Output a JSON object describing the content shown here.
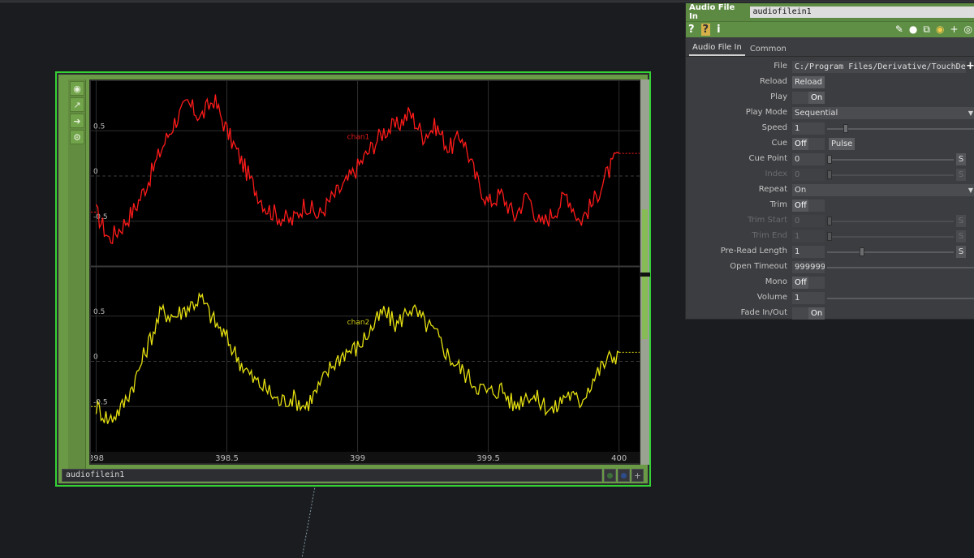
{
  "node": {
    "name": "audiofilein1",
    "toolbar_icons": [
      "target-icon",
      "chart-icon",
      "arrow-right-icon",
      "wrench-icon"
    ]
  },
  "chart_data": {
    "type": "line",
    "x_range": [
      397.98,
      400.06
    ],
    "x_ticks": [
      398,
      398.5,
      399,
      399.5,
      400
    ],
    "x_tick_labels": [
      "398",
      "398.5",
      "399",
      "399.5",
      "400"
    ],
    "channels": [
      {
        "name": "chan1",
        "color": "#ff1a1a",
        "y_range": [
          -1.0,
          1.05
        ],
        "y_ticks": [
          0.5,
          0,
          -0.5
        ],
        "y_tick_labels": [
          "0.5",
          "0",
          "-0.5"
        ],
        "x": [
          398.0,
          398.05,
          398.1,
          398.15,
          398.2,
          398.25,
          398.3,
          398.35,
          398.4,
          398.45,
          398.5,
          398.55,
          398.6,
          398.65,
          398.7,
          398.75,
          398.8,
          398.85,
          398.9,
          398.95,
          399.0,
          399.05,
          399.1,
          399.15,
          399.2,
          399.25,
          399.3,
          399.35,
          399.4,
          399.45,
          399.5,
          399.55,
          399.6,
          399.65,
          399.7,
          399.75,
          399.8,
          399.85,
          399.9,
          399.95,
          400.0
        ],
        "values": [
          -0.4,
          -0.7,
          -0.55,
          -0.35,
          -0.05,
          0.3,
          0.6,
          0.8,
          0.65,
          0.85,
          0.5,
          0.2,
          -0.1,
          -0.35,
          -0.45,
          -0.5,
          -0.3,
          -0.45,
          -0.25,
          -0.1,
          0.1,
          0.3,
          0.5,
          0.55,
          0.7,
          0.45,
          0.55,
          0.3,
          0.45,
          0.0,
          -0.3,
          -0.2,
          -0.45,
          -0.2,
          -0.55,
          -0.4,
          -0.2,
          -0.5,
          -0.3,
          0.0,
          0.25
        ]
      },
      {
        "name": "chan2",
        "color": "#e5e010",
        "y_range": [
          -1.0,
          1.05
        ],
        "y_ticks": [
          0.5,
          0,
          -0.5
        ],
        "y_tick_labels": [
          "0.5",
          "0",
          "-0.5"
        ],
        "x": [
          398.0,
          398.05,
          398.1,
          398.15,
          398.2,
          398.25,
          398.3,
          398.35,
          398.4,
          398.45,
          398.5,
          398.55,
          398.6,
          398.65,
          398.7,
          398.75,
          398.8,
          398.85,
          398.9,
          398.95,
          399.0,
          399.05,
          399.1,
          399.15,
          399.2,
          399.25,
          399.3,
          399.35,
          399.4,
          399.45,
          399.5,
          399.55,
          399.6,
          399.65,
          399.7,
          399.75,
          399.8,
          399.85,
          399.9,
          399.95,
          400.0
        ],
        "values": [
          -0.5,
          -0.65,
          -0.5,
          -0.2,
          0.2,
          0.55,
          0.5,
          0.6,
          0.7,
          0.45,
          0.25,
          0.0,
          -0.2,
          -0.3,
          -0.45,
          -0.4,
          -0.5,
          -0.3,
          -0.05,
          0.1,
          0.15,
          0.35,
          0.55,
          0.4,
          0.6,
          0.45,
          0.3,
          0.05,
          -0.1,
          -0.25,
          -0.35,
          -0.3,
          -0.5,
          -0.35,
          -0.45,
          -0.55,
          -0.35,
          -0.45,
          -0.2,
          0.0,
          0.1
        ]
      }
    ]
  },
  "panel": {
    "op_type": "Audio File In",
    "op_name": "audiofilein1",
    "header_icons": [
      "help-icon",
      "python-help-icon",
      "info-icon"
    ],
    "header_icons_text": [
      "?",
      "?",
      "i"
    ],
    "right_icons": [
      "pencil-icon",
      "comment-icon",
      "clone-icon",
      "python-icon",
      "plus-icon",
      "target-icon"
    ],
    "right_icons_text": [
      "✎",
      "●",
      "⧉",
      "◉",
      "+",
      "◎"
    ],
    "tabs": [
      "Audio File In",
      "Common"
    ],
    "params": {
      "file": {
        "label": "File",
        "value": "C:/Program Files/Derivative/TouchDe",
        "plus": "+"
      },
      "reload": {
        "label": "Reload",
        "button": "Reload"
      },
      "play": {
        "label": "Play",
        "off": "",
        "on": "On"
      },
      "play_mode": {
        "label": "Play Mode",
        "value": "Sequential"
      },
      "speed": {
        "label": "Speed",
        "value": "1"
      },
      "cue": {
        "label": "Cue",
        "off": "Off",
        "pulse": "Pulse"
      },
      "cue_point": {
        "label": "Cue Point",
        "value": "0",
        "s": "S"
      },
      "index": {
        "label": "Index",
        "value": "0",
        "s": "S"
      },
      "repeat": {
        "label": "Repeat",
        "value": "On"
      },
      "trim": {
        "label": "Trim",
        "off": "Off"
      },
      "trim_start": {
        "label": "Trim Start",
        "value": "0",
        "s": "S"
      },
      "trim_end": {
        "label": "Trim End",
        "value": "1",
        "s": "S"
      },
      "pre_read_length": {
        "label": "Pre-Read Length",
        "value": "1",
        "s": "S"
      },
      "open_timeout": {
        "label": "Open Timeout",
        "value": "999999"
      },
      "mono": {
        "label": "Mono",
        "off": "Off"
      },
      "volume": {
        "label": "Volume",
        "value": "1"
      },
      "fade": {
        "label": "Fade In/Out",
        "on": "On"
      }
    }
  }
}
